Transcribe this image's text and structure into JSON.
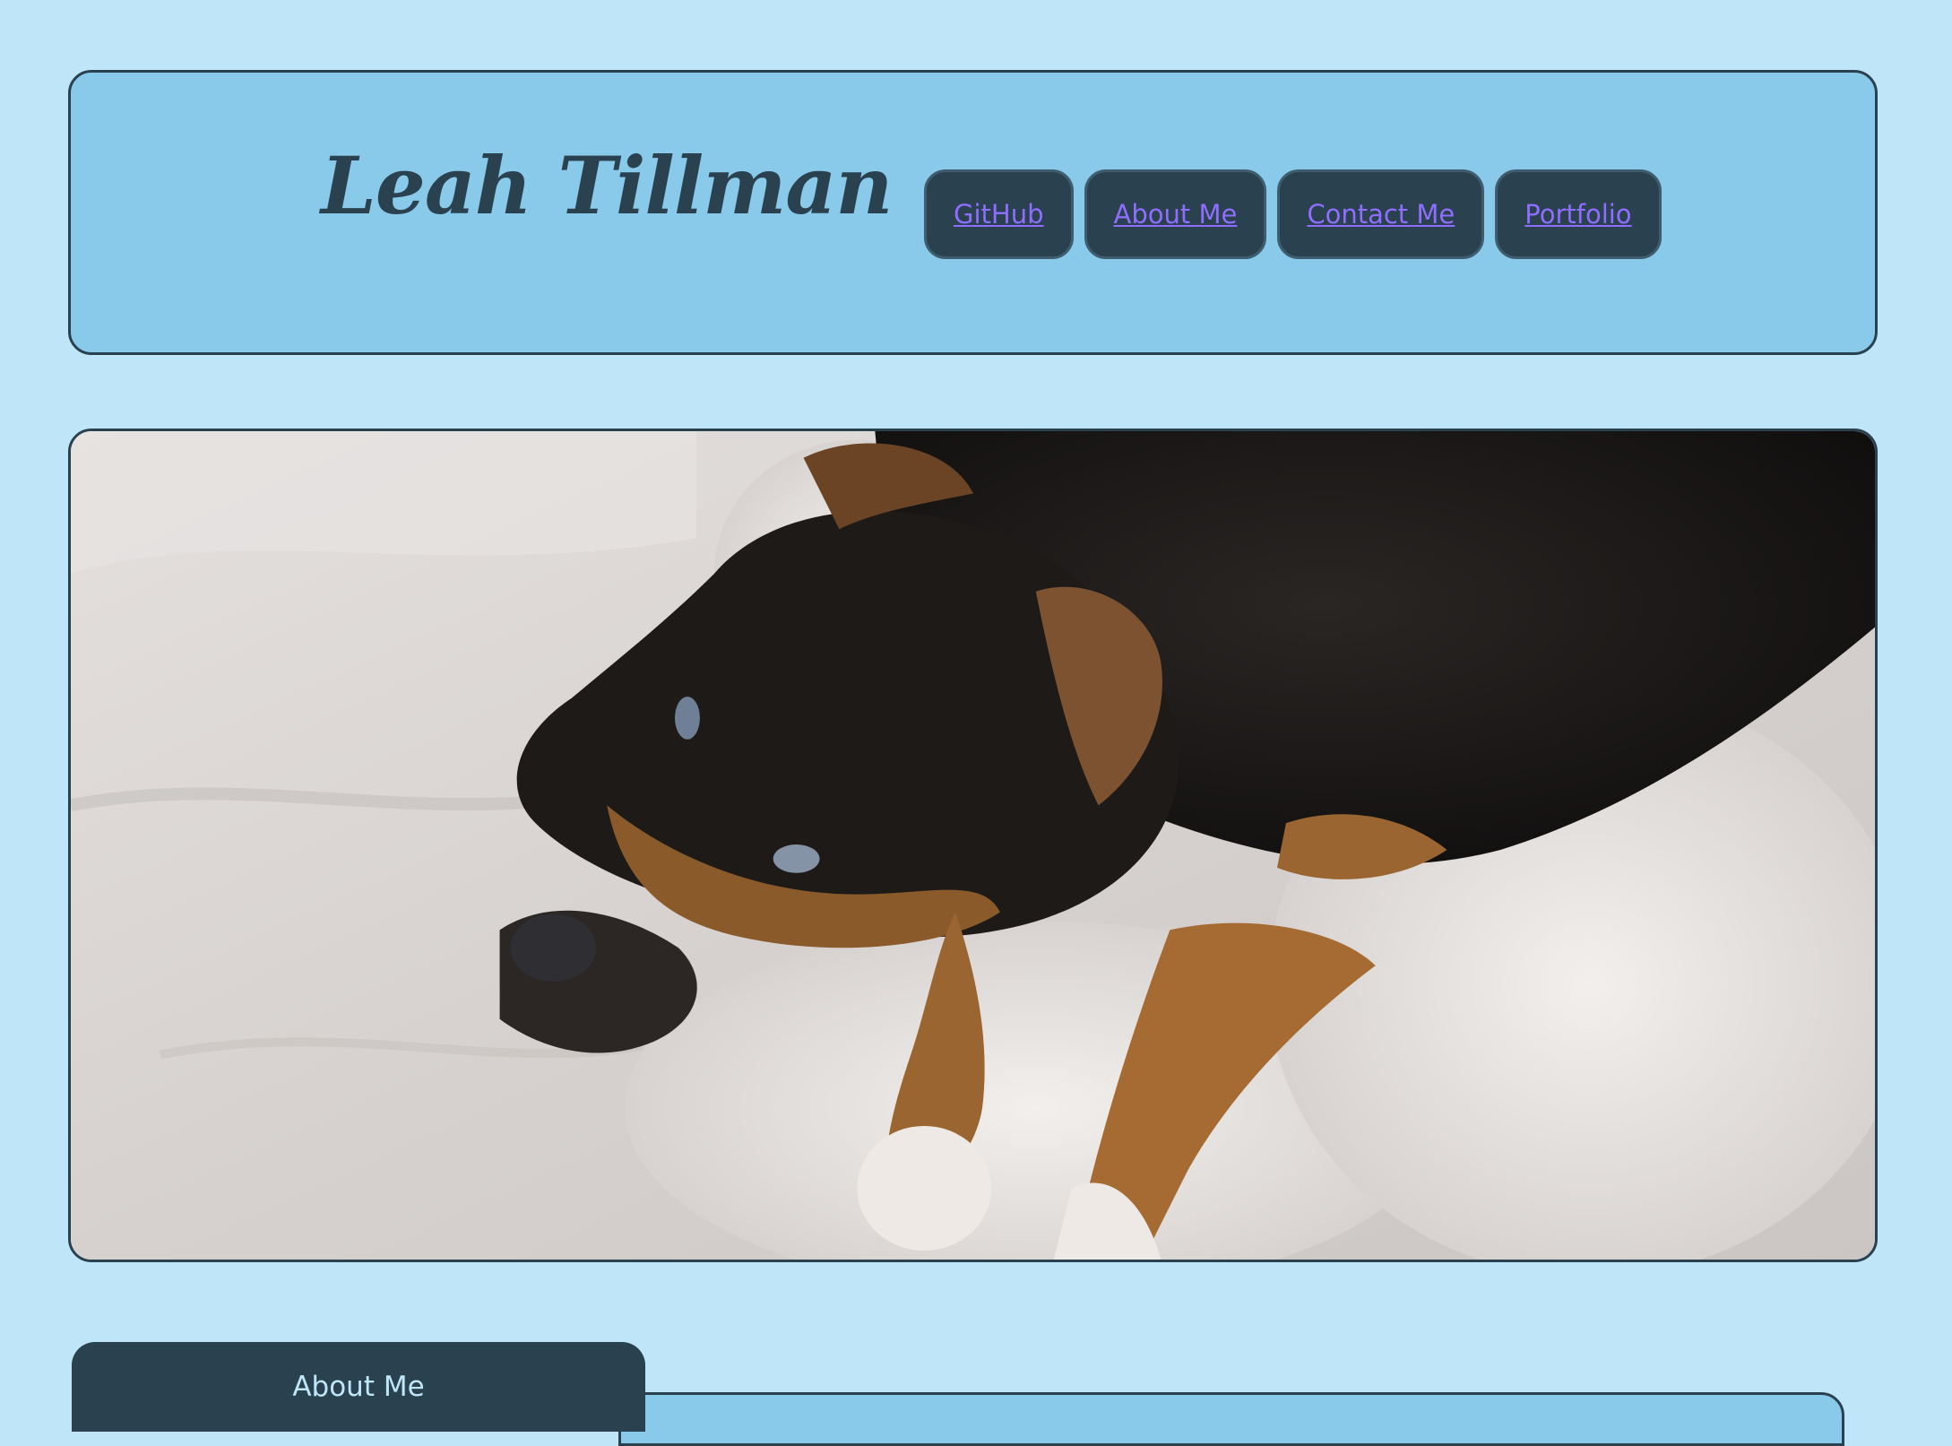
{
  "header": {
    "title": "Leah Tillman",
    "nav": [
      {
        "label": "GitHub"
      },
      {
        "label": "About Me"
      },
      {
        "label": "Contact Me"
      },
      {
        "label": "Portfolio"
      }
    ]
  },
  "hero": {
    "image_subject": "dog-photo"
  },
  "section": {
    "tab_label": "About Me"
  },
  "colors": {
    "page_background": "#bee6f8",
    "header_background": "#89c9ea",
    "dark_accent": "#2a4150",
    "link": "#8f6dff"
  }
}
